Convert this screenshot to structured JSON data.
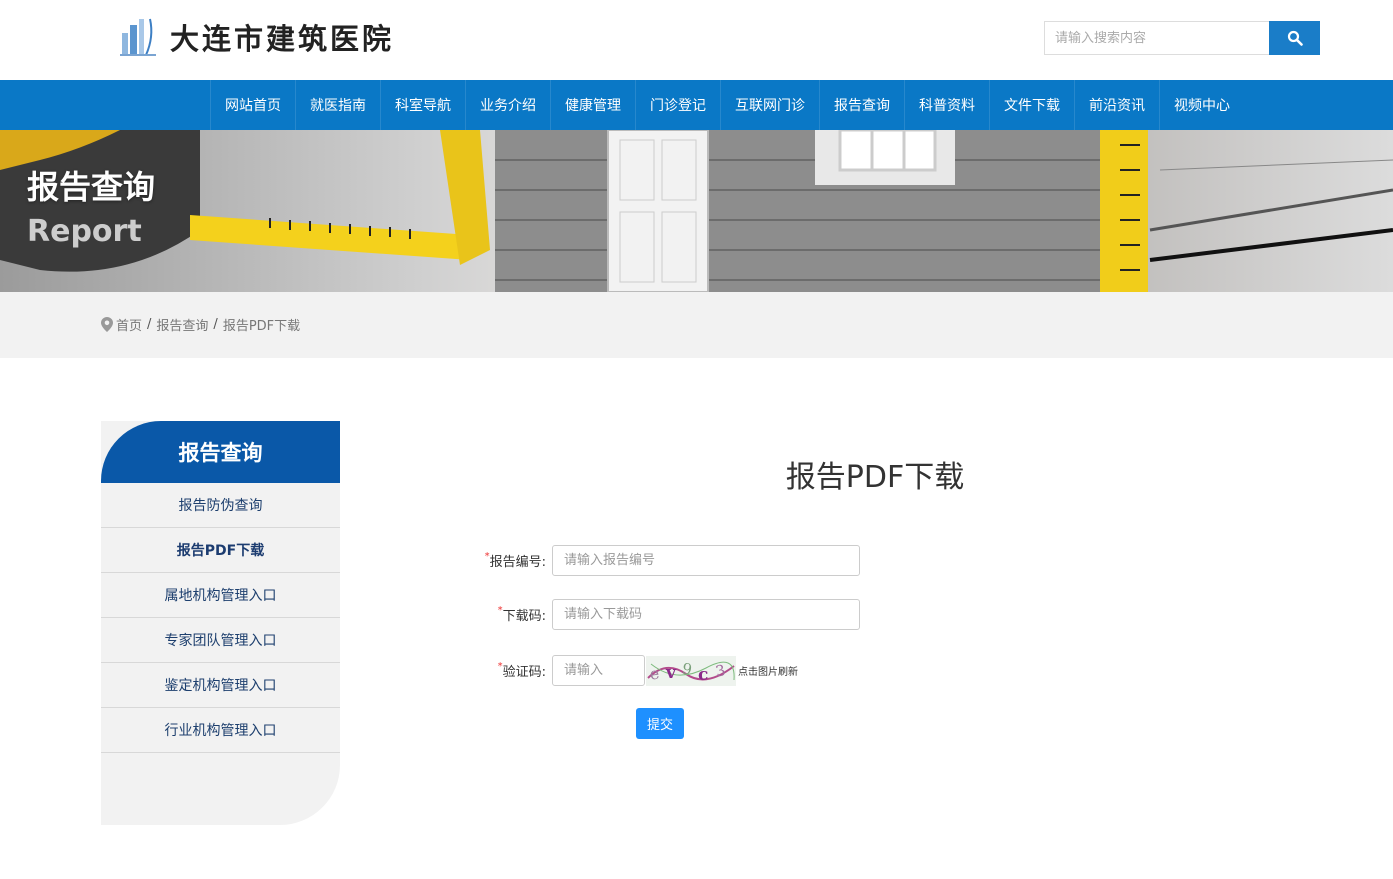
{
  "header": {
    "site_name": "大连市建筑医院",
    "search_placeholder": "请输入搜索内容"
  },
  "nav": {
    "items": [
      "网站首页",
      "就医指南",
      "科室导航",
      "业务介绍",
      "健康管理",
      "门诊登记",
      "互联网门诊",
      "报告查询",
      "科普资料",
      "文件下载",
      "前沿资讯",
      "视频中心"
    ]
  },
  "banner": {
    "title": "报告查询",
    "subtitle": "Report"
  },
  "breadcrumb": {
    "home": "首页",
    "section": "报告查询",
    "current": "报告PDF下载",
    "separator": "/"
  },
  "sidebar": {
    "heading": "报告查询",
    "items": [
      "报告防伪查询",
      "报告PDF下载",
      "属地机构管理入口",
      "专家团队管理入口",
      "鉴定机构管理入口",
      "行业机构管理入口"
    ],
    "active_index": 1
  },
  "form": {
    "title": "报告PDF下载",
    "required_mark": "*",
    "report_no_label": "报告编号:",
    "report_no_placeholder": "请输入报告编号",
    "download_code_label": "下载码:",
    "download_code_placeholder": "请输入下载码",
    "captcha_label": "验证码:",
    "captcha_placeholder": "请输入",
    "refresh_text": "点击图片刷新",
    "submit_label": "提交"
  },
  "colors": {
    "nav_bg": "#0a78c6",
    "sidebar_head": "#0a58a8",
    "submit_bg": "#1e90ff",
    "search_btn": "#1a7dc8"
  }
}
